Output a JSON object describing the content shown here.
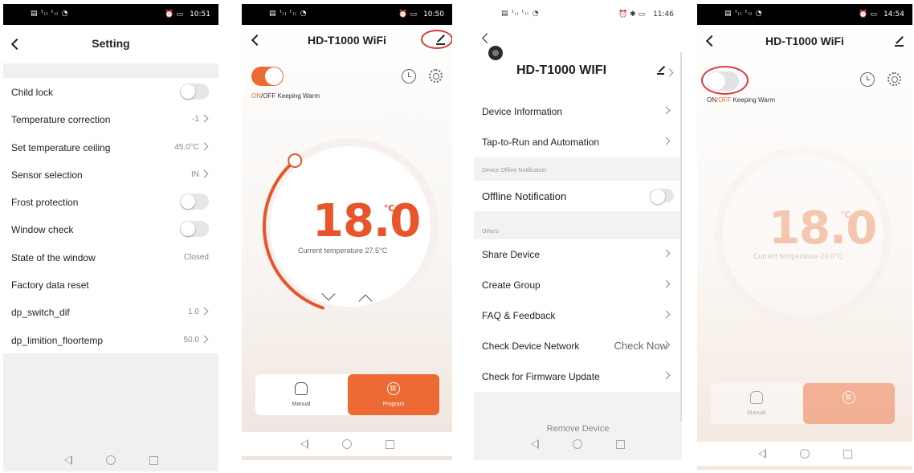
{
  "colors": {
    "accent": "#ee6a34",
    "temp": "#e8552a",
    "highlight_ring": "#d63a3a"
  },
  "panel1": {
    "status_time": "10:51",
    "title": "Setting",
    "rows": [
      {
        "label": "Child lock",
        "value": "",
        "kind": "toggle"
      },
      {
        "label": "Temperature correction",
        "value": "-1",
        "kind": "chevron"
      },
      {
        "label": "Set temperature ceiling",
        "value": "45.0°C",
        "kind": "chevron"
      },
      {
        "label": "Sensor selection",
        "value": "IN",
        "kind": "chevron"
      },
      {
        "label": "Frost protection",
        "value": "",
        "kind": "toggle"
      },
      {
        "label": "Window check",
        "value": "",
        "kind": "toggle"
      },
      {
        "label": "State of the window",
        "value": "Closed",
        "kind": "value"
      },
      {
        "label": "Factory data reset",
        "value": "",
        "kind": "plain"
      },
      {
        "label": "dp_switch_dif",
        "value": "1.0",
        "kind": "chevron"
      },
      {
        "label": "dp_limition_floortemp",
        "value": "50.0",
        "kind": "chevron"
      }
    ]
  },
  "panel2": {
    "status_time": "10:50",
    "title": "HD-T1000 WiFi",
    "on_label": "ON",
    "off_label": "/OFF",
    "mode_text": "Keeping Warm",
    "temperature": "18.0",
    "unit": "℃",
    "current_temp": "Current temperature 27.5°C",
    "manual_label": "Manual",
    "program_label": "Program",
    "power_on": true,
    "dial_level": 0.45
  },
  "panel3": {
    "status_time": "11:46",
    "title": "HD-T1000 WIFI",
    "rows_a": [
      {
        "label": "Device Information",
        "value": ""
      },
      {
        "label": "Tap-to-Run and Automation",
        "value": ""
      }
    ],
    "offline_header": "Device Offline Notification",
    "offline_label": "Offline Notification",
    "others_header": "Others",
    "rows_b": [
      {
        "label": "Share Device",
        "value": ""
      },
      {
        "label": "Create Group",
        "value": ""
      },
      {
        "label": "FAQ & Feedback",
        "value": ""
      },
      {
        "label": "Check Device Network",
        "value": "Check Now"
      },
      {
        "label": "Check for Firmware Update",
        "value": ""
      }
    ],
    "remove_label": "Remove Device"
  },
  "panel4": {
    "status_time": "14:54",
    "title": "HD-T1000 WiFi",
    "on_label": "ON",
    "off_label": "/OFF",
    "mode_text": "Keeping Warm",
    "temperature": "18.0",
    "unit": "℃",
    "current_temp": "Current temperature 26.0°C",
    "manual_label": "Manual",
    "power_on": false
  }
}
